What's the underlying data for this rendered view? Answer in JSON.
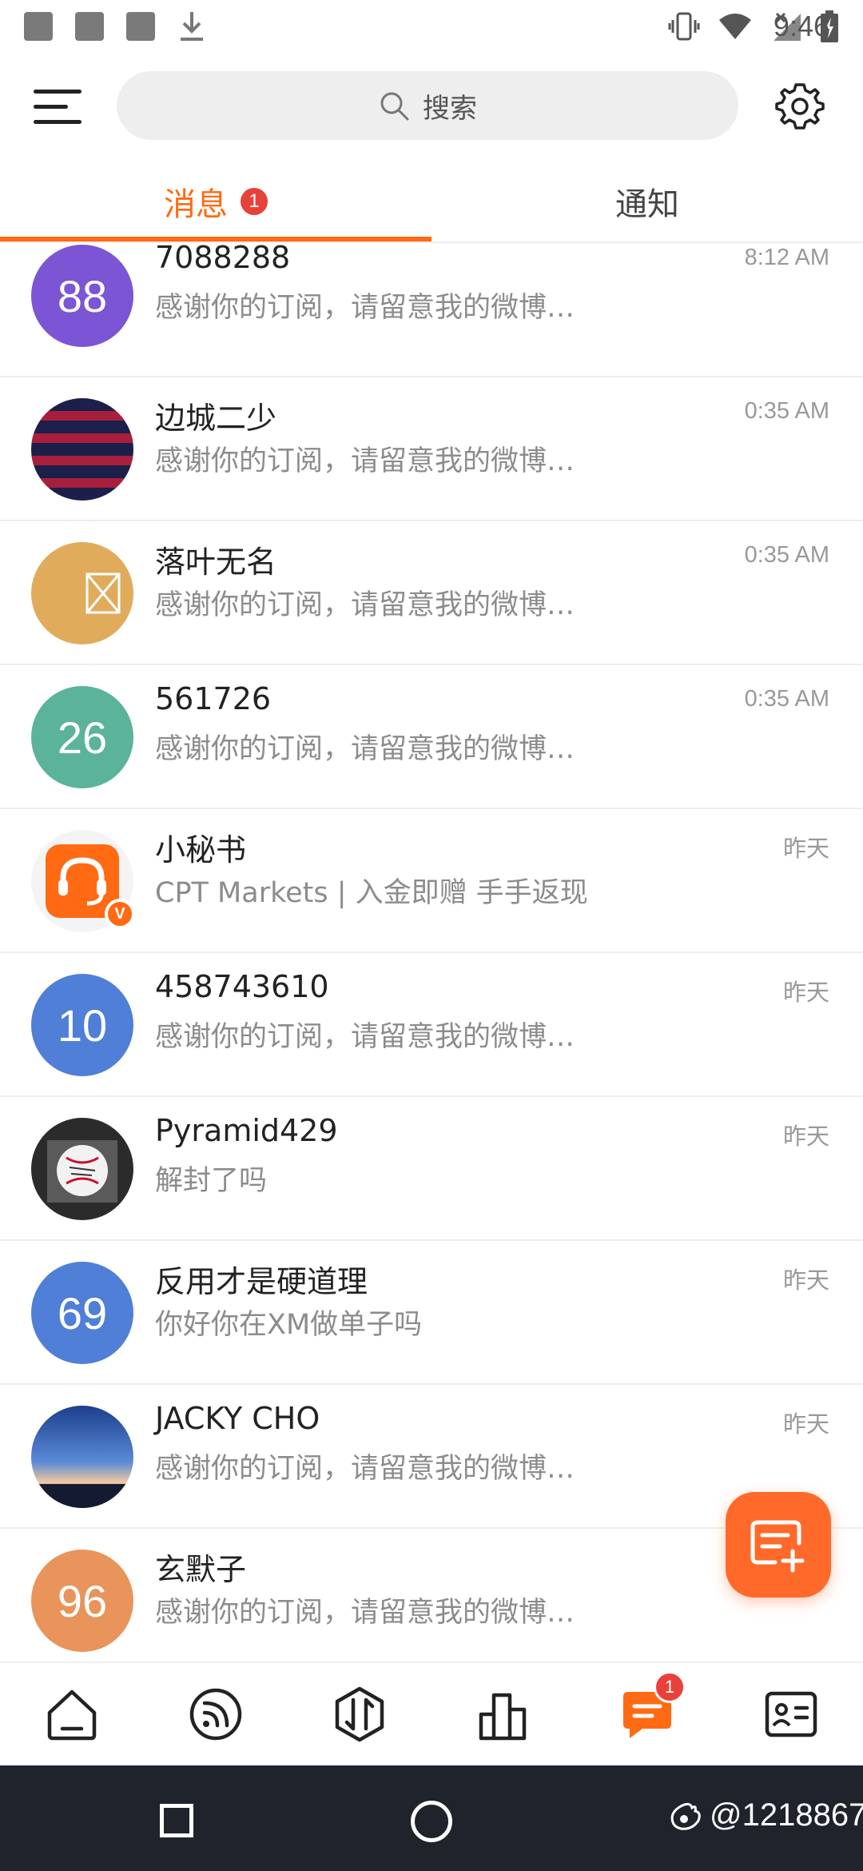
{
  "status_bar": {
    "time": "9:46"
  },
  "search": {
    "placeholder": "搜索"
  },
  "tabs": [
    {
      "label": "消息",
      "badge": "1"
    },
    {
      "label": "通知"
    }
  ],
  "conversations": [
    {
      "avatar_text": "88",
      "avatar_color": "#7b55d4",
      "name": "7088288",
      "preview": "感谢你的订阅，请留意我的微博…",
      "time": "8:12 AM"
    },
    {
      "avatar_text": "",
      "avatar_color": "#1b1f4a",
      "name": "边城二少",
      "preview": "感谢你的订阅，请留意我的微博…",
      "time": "0:35 AM"
    },
    {
      "avatar_text": "",
      "avatar_color": "#e0ac5c",
      "name": "落叶无名",
      "preview": "感谢你的订阅，请留意我的微博…",
      "time": "0:35 AM"
    },
    {
      "avatar_text": "26",
      "avatar_color": "#5bb39a",
      "name": "561726",
      "preview": "感谢你的订阅，请留意我的微博…",
      "time": "0:35 AM"
    },
    {
      "avatar_text": "",
      "avatar_color": "#ff6a13",
      "name": "小秘书",
      "preview": "CPT Markets | 入金即赠 手手返现",
      "time": "昨天",
      "verified": "V"
    },
    {
      "avatar_text": "10",
      "avatar_color": "#4f7fd6",
      "name": "458743610",
      "preview": "感谢你的订阅，请留意我的微博…",
      "time": "昨天"
    },
    {
      "avatar_text": "",
      "avatar_color": "#2b2b2b",
      "name": "Pyramid429",
      "preview": "解封了吗",
      "time": "昨天"
    },
    {
      "avatar_text": "69",
      "avatar_color": "#4f7fd6",
      "name": "反用才是硬道理",
      "preview": "你好你在XM做单子吗",
      "time": "昨天"
    },
    {
      "avatar_text": "",
      "avatar_color": "#3a66b8",
      "name": "JACKY CHO",
      "preview": "感谢你的订阅，请留意我的微博…",
      "time": "昨天"
    },
    {
      "avatar_text": "96",
      "avatar_color": "#e8945a",
      "name": "玄默子",
      "preview": "感谢你的订阅，请留意我的微博…",
      "time": ""
    }
  ],
  "bottom_nav": {
    "messages_badge": "1"
  },
  "watermark": "@1218867",
  "colors": {
    "accent": "#ff6a13",
    "badge": "#e8413a"
  }
}
